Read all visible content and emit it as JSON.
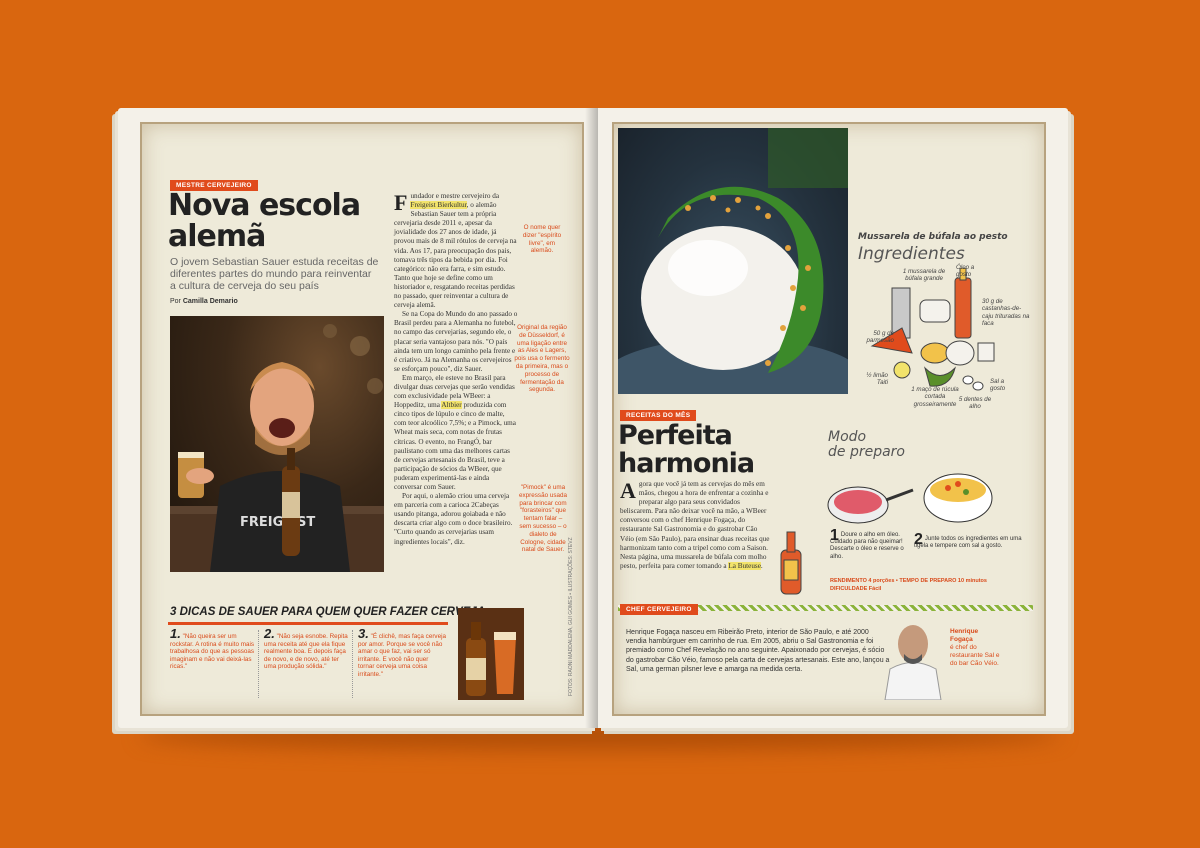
{
  "left": {
    "section_tag": "MESTRE CERVEJEIRO",
    "title_line1": "Nova escola",
    "title_line2": "alemã",
    "subtitle": "O jovem Sebastian Sauer estuda receitas de diferentes partes do mundo para reinventar a cultura de cerveja do seu país",
    "byline_prefix": "Por",
    "byline_author": "Camilla Demario",
    "dropcap": "F",
    "body_p1_a": "undador e mestre cervejeiro da",
    "body_p1_hl": "Freigeist Bierkultur",
    "body_p1_b": ", o alemão Sebastian Sauer tem a própria cervejaria desde 2011 e, apesar da jovialidade dos 27 anos de idade, já provou mais de 8 mil rótulos de cerveja na vida. Aos 17, para preocupação dos pais, tomava três tipos da bebida por dia. Foi categórico: não era farra, e sim estudo. Tanto que hoje se define como um historiador e, resgatando receitas perdidas no passado, quer reinventar a cultura de cerveja alemã.",
    "body_p2": "Se na Copa do Mundo do ano passado o Brasil perdeu para a Alemanha no futebol, no campo das cervejarias, segundo ele, o placar seria vantajoso para nós. \"O país ainda tem um longo caminho pela frente e é criativo. Já na Alemanha os cervejeiros se esforçam pouco\", diz Sauer.",
    "body_p3_a": "Em março, ele esteve no Brasil para divulgar duas cervejas que serão vendidas com exclusividade pela WBeer: a Hoppeditz, uma",
    "body_p3_hl": "Altbier",
    "body_p3_b": "produzida com cinco tipos de lúpulo e cinco de malte, com teor alcoólico 7,5%; e a Pimock, uma Wheat mais seca, com notas de frutas cítricas. O evento, no FrangÓ, bar paulistano com uma das melhores cartas de cervejas artesanais do Brasil, teve a participação de sócios da WBeer, que puderam experimentá-las e ainda conversar com Sauer.",
    "body_p4": "Por aqui, o alemão criou uma cerveja em parceria com a carioca 2Cabeças usando pitanga, adorou goiabada e não descarta criar algo com o doce brasileiro. \"Curto quando as cervejarias usam ingredientes locais\", diz.",
    "note1": "O nome quer dizer \"espírito livre\", em alemão.",
    "note2": "Original da região de Düsseldorf, é uma ligação entre as Ales e Lagers, pois usa o fermento da primeira, mas o processo de fermentação da segunda.",
    "note3": "\"Pimock\" é uma expressão usada para brincar com \"forasteiros\" que tentam falar – sem sucesso – o dialeto de Cologne, cidade natal de Sauer.",
    "dicas_title": "3 DICAS DE SAUER PARA QUEM QUER FAZER CERVEJA:",
    "dicas": [
      {
        "num": "1.",
        "text": "\"Não queira ser um rockstar. A rotina é muito mais trabalhosa do que as pessoas imaginam e não vai deixá-las ricas.\""
      },
      {
        "num": "2.",
        "text": "\"Não seja esnobe. Repita uma receita até que ela fique realmente boa. E depois faça de novo, e de novo, até ter uma produção sólida.\""
      },
      {
        "num": "3.",
        "text": "\"É clichê, mas faça cerveja por amor. Porque se você não amar o que faz, vai ser só irritante. E você não quer tornar cerveja uma coisa irritante.\""
      }
    ],
    "photo_beer_label": "FREIGE",
    "photo_shirt": "FREIGEIST",
    "credits": "FOTOS: RAONI MADDALENA, GUI GOMES • ILUSTRAÇÕES: STEVZ"
  },
  "right": {
    "recipe_title": "Mussarela de búfala ao pesto",
    "ingredients_heading": "Ingredientes",
    "ingredients": [
      "1 mussarela de búfala grande",
      "Óleo a gosto",
      "30 g de castanhas-de-caju trituradas na faca",
      "50 g de parmesão",
      "½ limão Taiti",
      "1 maço de rúcula cortada grosseiramente",
      "5 dentes de alho",
      "Sal a gosto"
    ],
    "section_tag": "RECEITAS DO MÊS",
    "title_line1": "Perfeita",
    "title_line2": "harmonia",
    "dropcap": "A",
    "body_a": "gora que você já tem as cervejas do mês em mãos, chegou a hora de enfrentar a cozinha e preparar algo para seus convidados beliscarem. Para não deixar você na mão, a WBeer conversou com o chef Henrique Fogaça, do restaurante Sal Gastronomia e do gastrobar Cão Véio (em São Paulo), para ensinar duas receitas que harmonizam tanto com a tripel como com a Saison. Nesta página, uma mussarela de búfala com molho pesto, perfeita para comer tomando a",
    "body_hl": "La Buteuse",
    "body_b": ".",
    "modo_line1": "Modo",
    "modo_line2": "de preparo",
    "steps": [
      {
        "num": "1",
        "text": "Doure o alho em óleo. Cuidado para não queimar! Descarte o óleo e reserve o alho."
      },
      {
        "num": "2",
        "text": "Junte todos os ingredientes em uma tigela e tempere com sal a gosto."
      }
    ],
    "meta_line1": "RENDIMENTO 4 porções • TEMPO DE PREPARO 10 minutos",
    "meta_line2": "DIFICULDADE Fácil",
    "chef_tag": "CHEF CERVEJEIRO",
    "chef_body": "Henrique Fogaça nasceu em Ribeirão Preto, interior de São Paulo, e até 2000 vendia hambúrguer em carrinho de rua. Em 2005, abriu o Sal Gastronomia e foi premiado como Chef Revelação no ano seguinte. Apaixonado por cervejas, é sócio do gastrobar Cão Véio, famoso pela carta de cervejas artesanais. Este ano, lançou a Sal, uma german pilsner leve e amarga na medida certa.",
    "chef_name": "Henrique Fogaça",
    "chef_caption": "é chef do restaurante Sal e do bar Cão Véio."
  }
}
